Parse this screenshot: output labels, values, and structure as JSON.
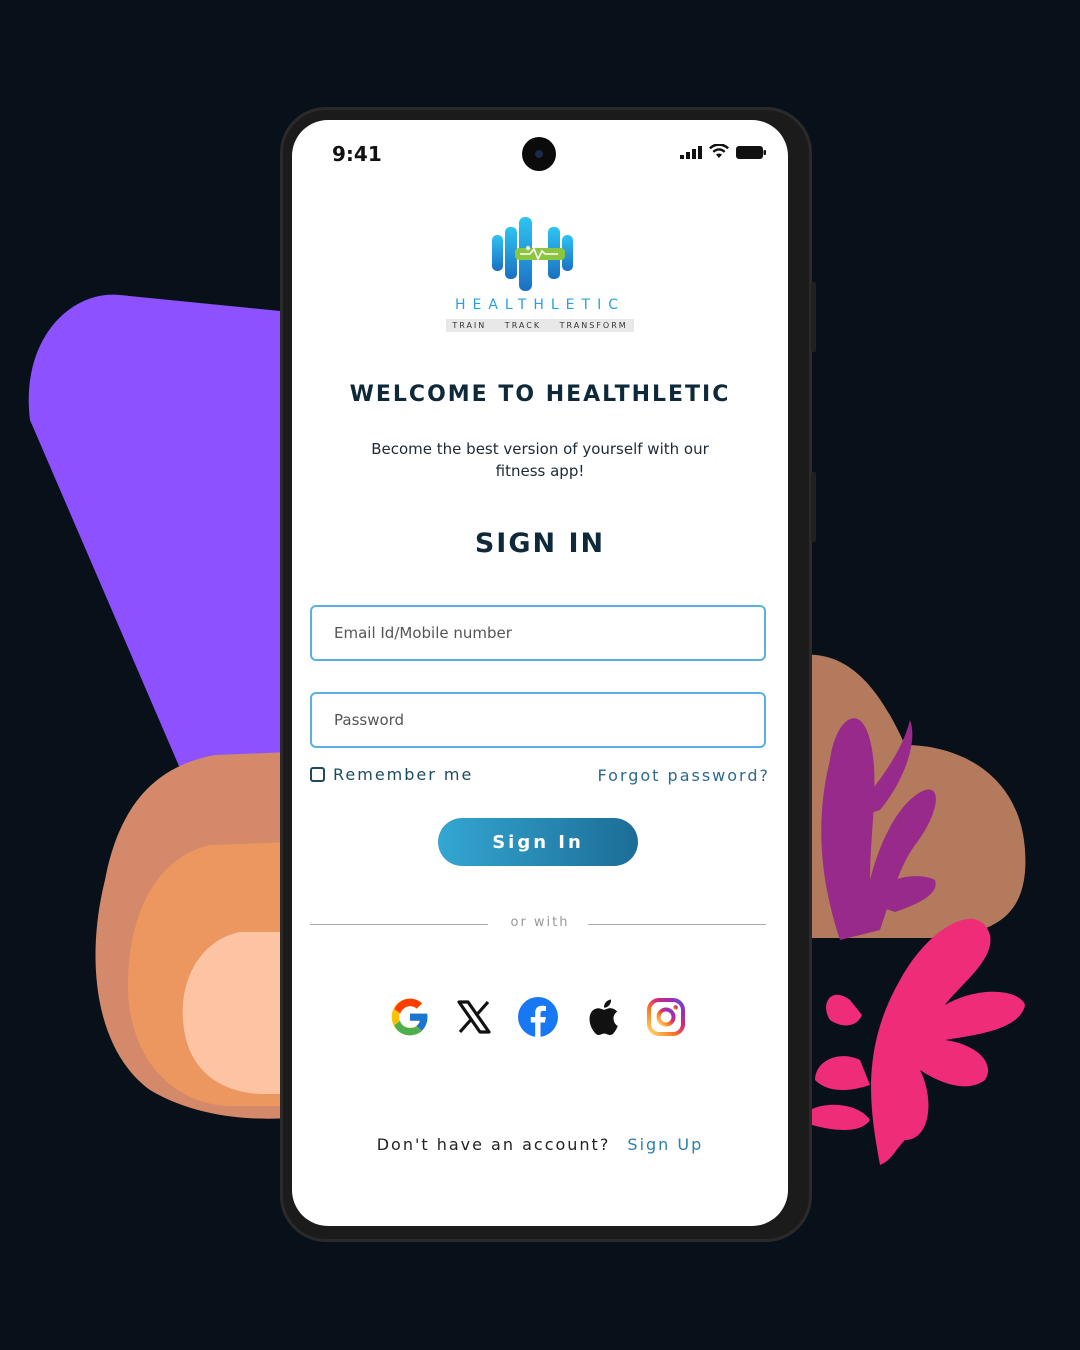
{
  "status_bar": {
    "time": "9:41",
    "icons": [
      "signal-icon",
      "wifi-icon",
      "battery-icon"
    ]
  },
  "brand": {
    "name": "HEALTHLETIC",
    "tagline": "TRAIN TRACK TRANSFORM",
    "logo_icon": "dumbbell-runner-logo",
    "colors": {
      "primary": "#2aa0e0",
      "accent": "#8cc63f"
    }
  },
  "welcome": {
    "title": "WELCOME TO HEALTHLETIC",
    "subtitle": "Become the best version of yourself with our fitness app!"
  },
  "signin": {
    "heading": "SIGN IN",
    "email_placeholder": "Email Id/Mobile number",
    "email_value": "",
    "password_placeholder": "Password",
    "password_value": "",
    "remember_me": "Remember me",
    "remember_checked": false,
    "forgot_password": "Forgot password?",
    "button_label": "Sign In",
    "or_with": "or with"
  },
  "social_logins": [
    {
      "name": "google",
      "icon": "google-icon"
    },
    {
      "name": "x",
      "icon": "x-icon"
    },
    {
      "name": "facebook",
      "icon": "facebook-icon"
    },
    {
      "name": "apple",
      "icon": "apple-icon"
    },
    {
      "name": "instagram",
      "icon": "instagram-icon"
    }
  ],
  "signup": {
    "question": "Don't have an account?",
    "link": "Sign Up"
  },
  "colors": {
    "page_background": "#08111a",
    "heading": "#0e2a3a",
    "field_border": "#5ab0e0",
    "button_gradient_start": "#34a6d2",
    "button_gradient_end": "#1c6d96",
    "link": "#2a80b0"
  }
}
